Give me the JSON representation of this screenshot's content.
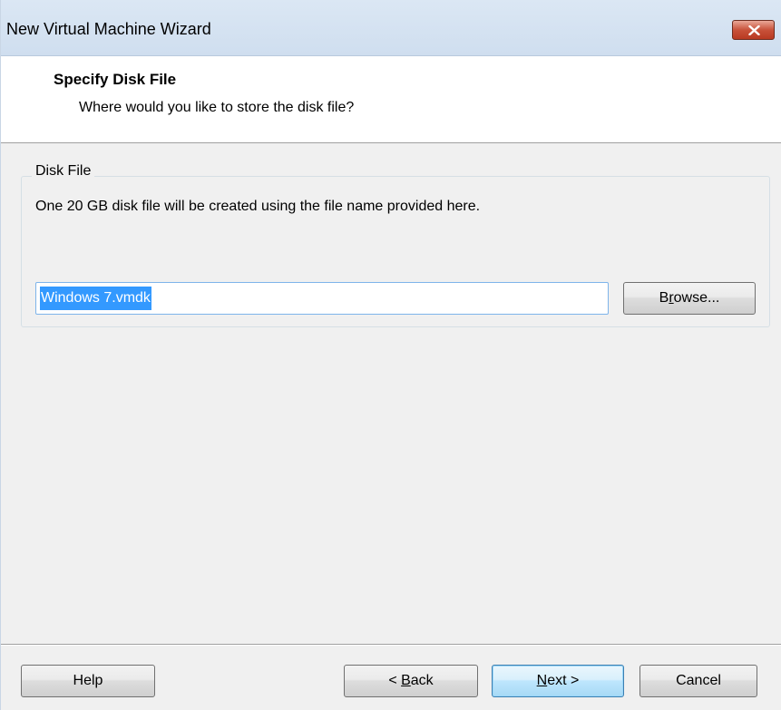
{
  "window": {
    "title": "New Virtual Machine Wizard",
    "close_icon": "close-icon"
  },
  "header": {
    "title": "Specify Disk File",
    "subtitle": "Where would you like to store the disk file?"
  },
  "disk_file": {
    "group_label": "Disk File",
    "description": "One 20 GB disk file will be created using the file name provided here.",
    "filename_value": "Windows 7.vmdk",
    "browse": {
      "pre": "B",
      "accel": "r",
      "post": "owse..."
    }
  },
  "footer": {
    "help_label": "Help",
    "back": {
      "pre": "< ",
      "accel": "B",
      "post": "ack"
    },
    "next": {
      "pre": "",
      "accel": "N",
      "post": "ext >"
    },
    "cancel_label": "Cancel"
  },
  "colors": {
    "titlebar": "#dbe7f4",
    "selection": "#3399ff",
    "close_button": "#c8523a"
  }
}
